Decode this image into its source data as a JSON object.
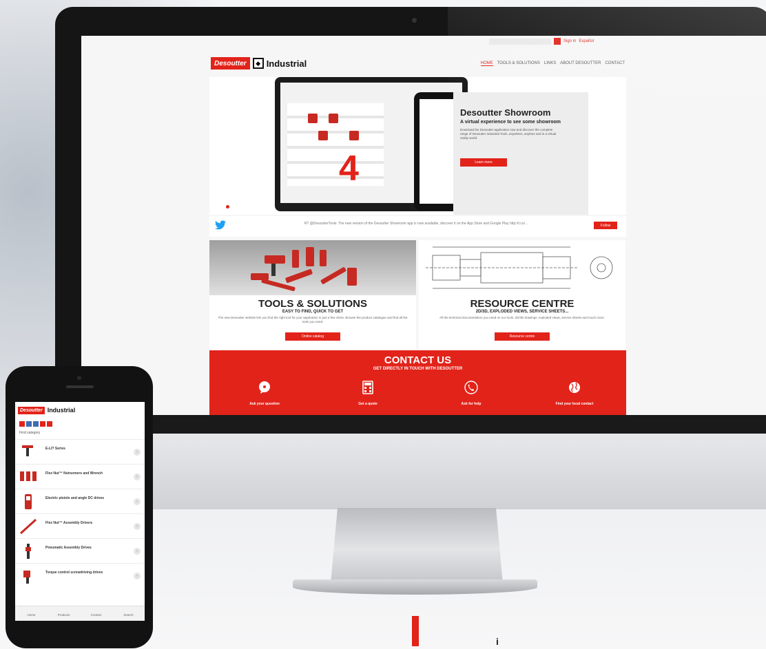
{
  "brand": {
    "logo_red": "Desoutter",
    "logo_text": "Industrial",
    "bottom_mark": "i"
  },
  "site": {
    "util": {
      "link1": "Sign in",
      "link2": "Español"
    },
    "nav": [
      {
        "label": "HOME",
        "active": true
      },
      {
        "label": "TOOLS & SOLUTIONS",
        "active": false
      },
      {
        "label": "LINKS",
        "active": false
      },
      {
        "label": "ABOUT DESOUTTER",
        "active": false
      },
      {
        "label": "CONTACT",
        "active": false
      }
    ],
    "hero": {
      "title": "Desoutter Showroom",
      "subtitle": "A virtual experience to see some showroom",
      "body": "Download the Desoutter application now and discover the complete range of Desoutter Industrial Tools, anywhere, anytime and in a virtual reality world.",
      "cta": "Learn more",
      "big_number": "4"
    },
    "tweet": {
      "text": "RT @DesoutterTools: The new version of the Desoutter Showroom app is now available, discover it on the App Store and Google Play http://t.co/...",
      "follow": "Follow"
    },
    "tools": {
      "title": "TOOLS & SOLUTIONS",
      "subtitle": "EASY TO FIND, QUICK TO GET",
      "body": "The new Desoutter website lets you find the right tool for your application in just a few clicks. Browse the product catalogue and find all the tools you need.",
      "cta": "Online catalog"
    },
    "resource": {
      "title": "RESOURCE CENTRE",
      "subtitle": "2D/3D, EXPLODED VIEWS, SERVICE SHEETS...",
      "body": "All the technical documentation you need on our tools: 2D/3D drawings, exploded views, service sheets and much more.",
      "cta": "Resource centre"
    },
    "contact": {
      "title": "CONTACT US",
      "subtitle": "GET DIRECTLY IN TOUCH WITH DESOUTTER",
      "items": [
        {
          "label": "Ask your question",
          "icon": "chat-bubble-icon"
        },
        {
          "label": "Get a quote",
          "icon": "calculator-icon"
        },
        {
          "label": "Ask for help",
          "icon": "phone-icon"
        },
        {
          "label": "Find your local contact",
          "icon": "globe-icon"
        }
      ]
    }
  },
  "phone": {
    "category_label": "Find category",
    "items": [
      {
        "label": "E-LIT Series"
      },
      {
        "label": "Flex Nut™ Nutrunners and Wrench"
      },
      {
        "label": "Electric pistols and angle DC drives"
      },
      {
        "label": "Flex Nut™ Assembly Drivers"
      },
      {
        "label": "Pneumatic Assembly Drives"
      },
      {
        "label": "Torque control screwdriving drives"
      }
    ],
    "tabs": [
      "Home",
      "Products",
      "Contact",
      "Search"
    ]
  },
  "colors": {
    "accent": "#e2231a",
    "bezel": "#151515"
  }
}
